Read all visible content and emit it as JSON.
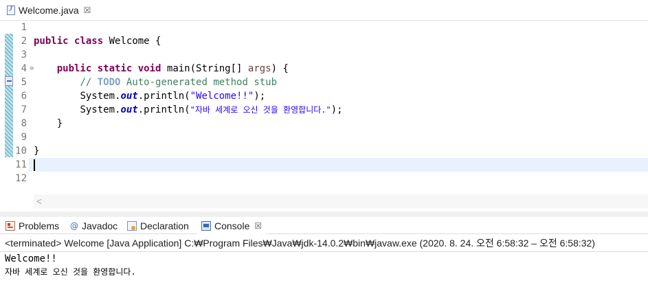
{
  "editor_tab": {
    "label": "Welcome.java",
    "close": "☒"
  },
  "editor": {
    "line_numbers": [
      "1",
      "2",
      "3",
      "4",
      "5",
      "6",
      "7",
      "8",
      "9",
      "10",
      "11",
      "12"
    ],
    "fold_marker": "⊖",
    "lines": {
      "l2": {
        "kw1": "public",
        "kw2": "class",
        "rest": " Welcome {"
      },
      "l4": {
        "indent": "    ",
        "kw1": "public",
        "kw2": "static",
        "kw3": "void",
        "mid": " main(String[] ",
        "param": "args",
        "end": ") {"
      },
      "l5": {
        "indent": "        ",
        "c1": "// ",
        "todo": "TODO",
        "c2": " Auto-generated method stub"
      },
      "l6": {
        "indent": "        ",
        "pre": "System.",
        "field": "out",
        "mid": ".println(",
        "str": "\"Welcome!!\"",
        "end": ");"
      },
      "l7": {
        "indent": "        ",
        "pre": "System.",
        "field": "out",
        "mid": ".println(",
        "str": "\"자바 세계로 오신 것을 환영합니다.\"",
        "end": ");"
      },
      "l8": {
        "indent": "    ",
        "text": "}"
      },
      "l10": {
        "text": "}"
      }
    },
    "scroll_left": "<"
  },
  "views": {
    "tabs": [
      {
        "label": "Problems"
      },
      {
        "label": "Javadoc"
      },
      {
        "label": "Declaration"
      },
      {
        "label": "Console"
      }
    ],
    "javadoc_glyph": "@",
    "close": "☒"
  },
  "console": {
    "header": "<terminated> Welcome [Java Application] C:₩Program Files₩Java₩jdk-14.0.2₩bin₩javaw.exe  (2020. 8. 24. 오전 6:58:32 – 오전 6:58:32)",
    "output": [
      "Welcome!!",
      "자바 세계로 오신 것을 환영합니다."
    ]
  },
  "colors": {
    "keyword": "#7f0055",
    "comment": "#3f7f5f",
    "string": "#2a00ff",
    "field": "#0000c0",
    "current_line": "#e8f2fe"
  }
}
